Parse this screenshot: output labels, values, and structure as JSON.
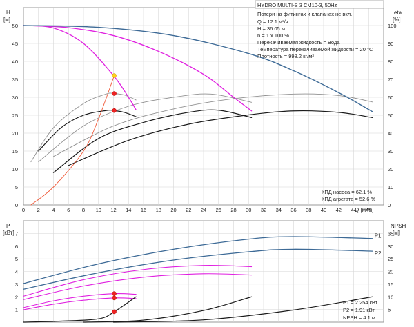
{
  "header": {
    "title": "HYDRO MULTI-S 3 CM10-3, 50Hz"
  },
  "info_lines": [
    "Потери на фитингах и клапанах не вкл.",
    "Q = 12.1 м³/ч",
    "H = 36.05 м",
    "n = 1 x 100 %",
    "Перекачиваемая жидкость = Вода",
    "Температура перекачиваемой жидкости = 20 °C",
    "Плотность = 998.2 кг/м³"
  ],
  "efficiency_text": [
    "КПД насоса = 62.1 %",
    "КПД агрегата = 52.6 %"
  ],
  "power_text": [
    "P1 = 2.254 кВт",
    "P2 = 1.91 кВт",
    "NPSH = 4.1 м"
  ],
  "colors": {
    "curve_blue": "#3d6a96",
    "curve_magenta": "#e020e0",
    "curve_black": "#1a1a1a",
    "curve_gray": "#909090",
    "system_curve": "#f05a3a",
    "point_red": "#ee2222",
    "point_yellow": "#ffd21a",
    "grid": "#d6d6d6",
    "frame": "#9a9a9a"
  },
  "chart_data": [
    {
      "type": "line",
      "name": "head-efficiency",
      "x_label_unit": "Q [м³/ч]",
      "ylabel_left": "H",
      "ylabel_left_unit": "[м]",
      "ylabel_right": "eta",
      "ylabel_right_unit": "[%]",
      "xlim": [
        0,
        48
      ],
      "ylim_left": [
        0,
        55
      ],
      "ylim_right": [
        0,
        110
      ],
      "x_ticks": [
        0,
        2,
        4,
        6,
        8,
        10,
        12,
        14,
        16,
        18,
        20,
        22,
        24,
        26,
        28,
        30,
        32,
        34,
        36,
        38,
        40,
        42,
        44,
        46
      ],
      "y_ticks_left": [
        0,
        5,
        10,
        15,
        20,
        25,
        30,
        35,
        40,
        45,
        50
      ],
      "y_ticks_right": [
        0,
        10,
        20,
        30,
        40,
        50,
        60,
        70,
        80,
        90,
        100
      ],
      "grid": true,
      "head_curves": [
        {
          "role": "single-pump",
          "style": "magenta",
          "x": [
            0,
            4,
            8,
            12,
            14,
            15
          ],
          "y": [
            50,
            49.3,
            45,
            36.05,
            30,
            26.5
          ]
        },
        {
          "role": "two-pumps",
          "style": "magenta",
          "x": [
            0,
            6,
            12,
            18,
            24,
            28,
            30.4
          ],
          "y": [
            50,
            49.4,
            47.2,
            42.8,
            36.4,
            30,
            26.2
          ]
        },
        {
          "role": "three-pumps",
          "style": "blue",
          "x": [
            0,
            10,
            20,
            30,
            36,
            42,
            46.5
          ],
          "y": [
            50,
            49.5,
            47.2,
            42.2,
            37.4,
            31.3,
            26
          ]
        }
      ],
      "efficiency_curves": [
        {
          "role": "pump-1",
          "style": "black",
          "x": [
            2,
            5,
            8,
            11,
            12.1,
            13.5,
            15
          ],
          "y": [
            30,
            43,
            50,
            52.6,
            52.6,
            51.5,
            49.2
          ]
        },
        {
          "role": "pump-1",
          "style": "gray",
          "x": [
            1,
            4,
            8,
            11,
            12.1,
            13.5,
            15
          ],
          "y": [
            24,
            43,
            56.5,
            61.8,
            62.1,
            61.2,
            58.5
          ]
        },
        {
          "role": "pump-2",
          "style": "black",
          "x": [
            4,
            10,
            16,
            22,
            26,
            30.4
          ],
          "y": [
            18,
            37,
            46,
            51.6,
            52.8,
            48.7
          ]
        },
        {
          "role": "pump-2",
          "style": "gray",
          "x": [
            2,
            8,
            14,
            20,
            25,
            30.4
          ],
          "y": [
            24,
            44,
            55,
            60,
            61.8,
            57.2
          ]
        },
        {
          "role": "pump-3",
          "style": "black",
          "x": [
            6,
            14,
            22,
            30,
            36,
            42,
            46.5
          ],
          "y": [
            22,
            36,
            45,
            50.2,
            52.4,
            51.6,
            48.7
          ]
        },
        {
          "role": "pump-3",
          "style": "gray",
          "x": [
            4,
            12,
            20,
            28,
            36,
            42,
            46.5
          ],
          "y": [
            27,
            44,
            53.5,
            59.2,
            61.8,
            61,
            57.4
          ]
        }
      ],
      "system_curve": {
        "x": [
          1,
          4,
          8,
          10,
          12.1
        ],
        "y": [
          0,
          5,
          15,
          24,
          36.05
        ]
      },
      "points": [
        {
          "name": "duty",
          "color": "yellow",
          "x": 12.1,
          "y": 36.05
        },
        {
          "name": "eta-pump",
          "color": "red",
          "x": 12.1,
          "y": 31.05
        },
        {
          "name": "eta-unit",
          "color": "red",
          "x": 12.1,
          "y": 26.3
        }
      ]
    },
    {
      "type": "line",
      "name": "power-npsh",
      "ylabel_left": "P",
      "ylabel_left_unit": "[кВт]",
      "ylabel_right": "NPSH",
      "ylabel_right_unit": "[м]",
      "xlim": [
        0,
        48
      ],
      "ylim_left": [
        0,
        8
      ],
      "ylim_right": [
        0,
        40
      ],
      "y_ticks_left": [
        1,
        2,
        3,
        4,
        5,
        6,
        7
      ],
      "y_ticks_right": [
        5,
        10,
        15,
        20,
        25,
        30,
        35
      ],
      "grid": true,
      "series": [
        {
          "name": "P1",
          "style": "blue",
          "x": [
            0,
            10,
            20,
            30,
            36,
            46.5
          ],
          "y": [
            3.05,
            4.6,
            5.75,
            6.55,
            6.75,
            6.6
          ]
        },
        {
          "name": "P2",
          "style": "blue",
          "x": [
            0,
            10,
            20,
            30,
            36,
            46.5
          ],
          "y": [
            2.6,
            3.9,
            4.9,
            5.55,
            5.75,
            5.6
          ]
        },
        {
          "style": "magenta",
          "x": [
            0,
            8,
            16,
            24,
            30.4
          ],
          "y": [
            2.05,
            3.35,
            4.15,
            4.48,
            4.38
          ]
        },
        {
          "style": "magenta",
          "x": [
            0,
            8,
            16,
            24,
            30.4
          ],
          "y": [
            1.78,
            2.85,
            3.55,
            3.82,
            3.72
          ]
        },
        {
          "style": "magenta",
          "x": [
            0,
            4,
            8,
            12.1,
            15
          ],
          "y": [
            1.15,
            1.68,
            2.05,
            2.25,
            2.2
          ]
        },
        {
          "style": "magenta",
          "x": [
            0,
            4,
            8,
            12.1,
            15
          ],
          "y": [
            0.98,
            1.42,
            1.73,
            1.91,
            1.86
          ]
        },
        {
          "style": "black",
          "role": "npsh",
          "x": [
            0,
            5,
            10,
            12.1,
            15
          ],
          "y": [
            0,
            0.4,
            1.3,
            4.1,
            10
          ]
        },
        {
          "style": "black",
          "role": "npsh",
          "x": [
            8,
            16,
            24,
            30.4
          ],
          "y": [
            0,
            0.8,
            4.6,
            10
          ]
        },
        {
          "style": "black",
          "role": "npsh",
          "x": [
            12,
            24,
            36,
            46.5
          ],
          "y": [
            0,
            0.9,
            4.8,
            10
          ]
        }
      ],
      "points": [
        {
          "name": "P1",
          "color": "red",
          "x": 12.1,
          "y": 2.254
        },
        {
          "name": "P2",
          "color": "red",
          "x": 12.1,
          "y": 1.91
        },
        {
          "name": "NPSH",
          "color": "red",
          "x": 12.1,
          "y": 0.82
        }
      ],
      "series_labels": [
        "P1",
        "P2"
      ]
    }
  ]
}
